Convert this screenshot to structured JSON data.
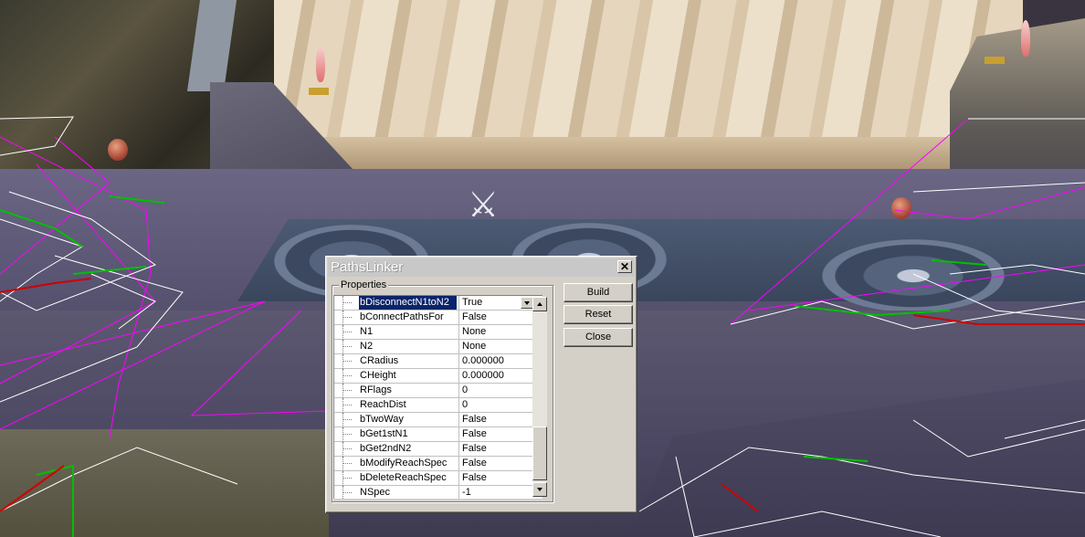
{
  "dialog": {
    "title": "PathsLinker",
    "close_glyph": "✕",
    "group_label": "Properties",
    "properties": [
      {
        "name": "bDisconnectN1toN2",
        "value": "True",
        "selected": true,
        "dropdown": true
      },
      {
        "name": "bConnectPathsFor",
        "value": "False"
      },
      {
        "name": "N1",
        "value": "None"
      },
      {
        "name": "N2",
        "value": "None"
      },
      {
        "name": "CRadius",
        "value": "0.000000"
      },
      {
        "name": "CHeight",
        "value": "0.000000"
      },
      {
        "name": "RFlags",
        "value": "0"
      },
      {
        "name": "ReachDist",
        "value": "0"
      },
      {
        "name": "bTwoWay",
        "value": "False"
      },
      {
        "name": "bGet1stN1",
        "value": "False"
      },
      {
        "name": "bGet2ndN2",
        "value": "False"
      },
      {
        "name": "bModifyReachSpec",
        "value": "False"
      },
      {
        "name": "bDeleteReachSpec",
        "value": "False"
      },
      {
        "name": "NSpec",
        "value": "-1"
      }
    ],
    "buttons": {
      "build": "Build",
      "reset": "Reset",
      "close": "Close"
    }
  },
  "viewport": {
    "icons": [
      "crossed-swords-icon",
      "apple-icon",
      "torch-icon"
    ],
    "path_colors": {
      "path": "#ffffff",
      "reach": "#ff00ff",
      "green": "#00c000",
      "red": "#d00000"
    }
  }
}
